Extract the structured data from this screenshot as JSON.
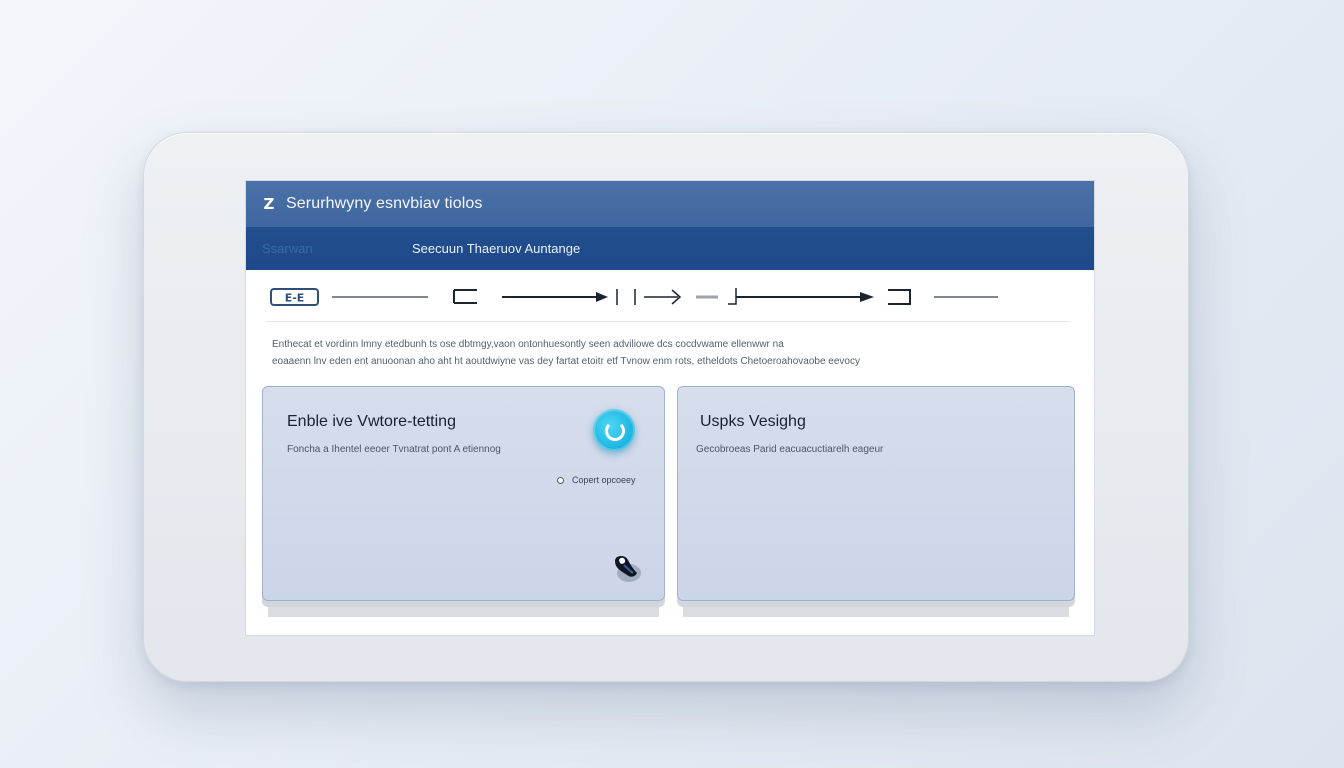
{
  "app": {
    "title": "Serurhwyny esnvbiav tiolos",
    "logo_icon": "z-logo-icon"
  },
  "nav": {
    "dim_item": "Ssarwan",
    "active_item": "Seecuun Thaeruov  Auntange"
  },
  "stepper": {
    "first_step_label": "E-E",
    "step_icons": [
      "bracket-left-icon",
      "arrow-right-icon",
      "pause-icon",
      "chevron-right-icon",
      "arrow-right-icon",
      "bracket-right-icon"
    ]
  },
  "description": {
    "line1": "Enthecat et vordinn lmny etedbunh ts ose dbtmgy,vaon ontonhuesontly seen adviliowe dcs cocdvwame ellenwwr  na",
    "line2": "eoaaenn lnv eden ent anuoonan aho aht ht aoutdwiyne vas dey fartat etoitr etf Tvnow enm rots, etheldots Chetoeroahovaobe eevocy"
  },
  "cards": {
    "left": {
      "title": "Enble ive Vwtore-tetting",
      "subtitle": "Foncha a Ihentel eeoer Tvnatrat pont A etiennog",
      "toggle_icon": "toggle-refresh-icon",
      "option_label": "Copert opcoeey",
      "cursor_icon": "mouse-cursor-icon"
    },
    "right": {
      "title": "Uspks Vesighg",
      "subtitle": "Gecobroeas Parid eacuacuctiarelh eageur"
    }
  },
  "colors": {
    "titlebar": "#4a72a8",
    "navbar": "#1e4889",
    "card_fill": "#cbd5e8",
    "toggle": "#17b3e0",
    "background": "#e6ecf5"
  }
}
